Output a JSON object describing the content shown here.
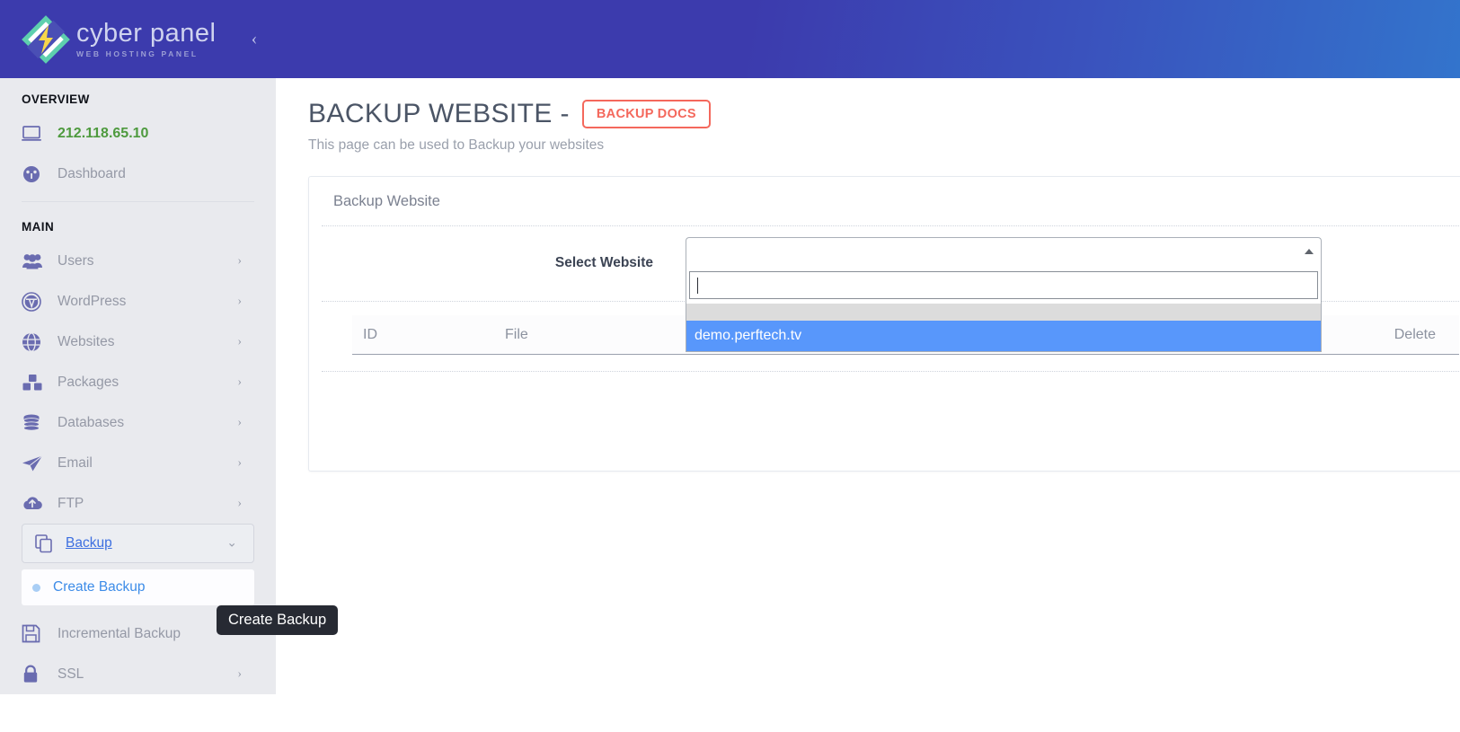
{
  "brand": {
    "name": "cyber panel",
    "tagline": "WEB HOSTING PANEL",
    "collapse_icon": "chevron-left-icon",
    "header_gradient_start": "#3c3bad",
    "header_gradient_end": "#3374cc"
  },
  "sidebar": {
    "sections": [
      {
        "label": "OVERVIEW"
      },
      {
        "label": "MAIN"
      }
    ],
    "overview_items": [
      {
        "label": "212.118.65.10",
        "icon": "monitor-icon",
        "is_ip": true,
        "caret": false
      },
      {
        "label": "Dashboard",
        "icon": "dashboard-gauge-icon",
        "is_ip": false,
        "caret": false
      }
    ],
    "main_items": [
      {
        "label": "Users",
        "icon": "users-icon",
        "caret": "chevron-right-icon"
      },
      {
        "label": "WordPress",
        "icon": "wordpress-icon",
        "caret": "chevron-right-icon"
      },
      {
        "label": "Websites",
        "icon": "globe-icon",
        "caret": "chevron-right-icon"
      },
      {
        "label": "Packages",
        "icon": "packages-boxes-icon",
        "caret": "chevron-right-icon"
      },
      {
        "label": "Databases",
        "icon": "database-icon",
        "caret": "chevron-right-icon"
      },
      {
        "label": "Email",
        "icon": "paper-plane-icon",
        "caret": "chevron-right-icon"
      },
      {
        "label": "FTP",
        "icon": "cloud-upload-icon",
        "caret": "chevron-right-icon"
      }
    ],
    "active_parent": {
      "label": "Backup",
      "icon": "copy-files-icon",
      "caret": "chevron-down-icon"
    },
    "active_child": {
      "label": "Create Backup",
      "icon": "bullet-dot-icon"
    },
    "after_items": [
      {
        "label": "Incremental Backup",
        "icon": "floppy-save-icon",
        "caret": ""
      },
      {
        "label": "SSL",
        "icon": "lock-icon",
        "caret": "chevron-right-icon"
      }
    ]
  },
  "tooltip": {
    "text": "Create Backup"
  },
  "page": {
    "title": "BACKUP WEBSITE -",
    "docs_badge": "BACKUP DOCS",
    "subtitle": "This page can be used to Backup your websites"
  },
  "card": {
    "heading": "Backup Website",
    "form": {
      "label": "Select Website",
      "select": {
        "selected_value": "",
        "search_value": "",
        "arrow_icon": "caret-up-icon",
        "options": [
          {
            "label": "demo.perftech.tv",
            "highlighted": true
          }
        ]
      }
    },
    "table": {
      "columns": [
        "ID",
        "File",
        "Delete"
      ],
      "rows": []
    }
  },
  "colors": {
    "accent_blue": "#5897fb",
    "link_blue": "#3d8ce8",
    "danger_red": "#f4685c",
    "ip_green": "#4e9a3e",
    "sidebar_bg": "#e9eaee"
  }
}
